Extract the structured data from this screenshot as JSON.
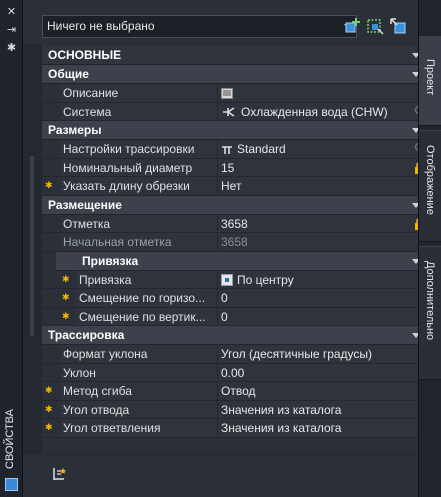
{
  "palette": {
    "title": "СВОЙСТВА",
    "selector": "Ничего не выбрано"
  },
  "tabs": [
    "Проект",
    "Отображение",
    "Дополнительно"
  ],
  "section": {
    "title": "ОСНОВНЫЕ"
  },
  "general": {
    "title": "Общие",
    "description_label": "Описание",
    "system_label": "Система",
    "system_value": "Охлажденная вода (CHW)"
  },
  "sizes": {
    "title": "Размеры",
    "routing_label": "Настройки трассировки",
    "routing_value": "Standard",
    "diameter_label": "Номинальный диаметр",
    "diameter_value": "15",
    "cut_label": "Указать длину обрезки",
    "cut_value": "Нет"
  },
  "placement": {
    "title": "Размещение",
    "elevation_label": "Отметка",
    "elevation_value": "3658",
    "start_label": "Начальная отметка",
    "start_value": "3658"
  },
  "snap": {
    "title": "Привязка",
    "snap_label": "Привязка",
    "snap_value": "По центру",
    "hoff_label": "Смещение  по  горизо...",
    "hoff_value": "0",
    "voff_label": "Смещение  по  вертик...",
    "voff_value": "0"
  },
  "routing": {
    "title": "Трассировка",
    "slope_format_label": "Формат уклона",
    "slope_format_value": "Угол (десятичные градусы)",
    "slope_label": "Уклон",
    "slope_value": "0.00",
    "bend_label": "Метод сгиба",
    "bend_value": "Отвод",
    "branch_angle_label": "Угол отвода",
    "branch_angle_value": "Значения из каталога",
    "tee_angle_label": "Угол ответвления",
    "tee_angle_value": "Значения из каталога"
  }
}
